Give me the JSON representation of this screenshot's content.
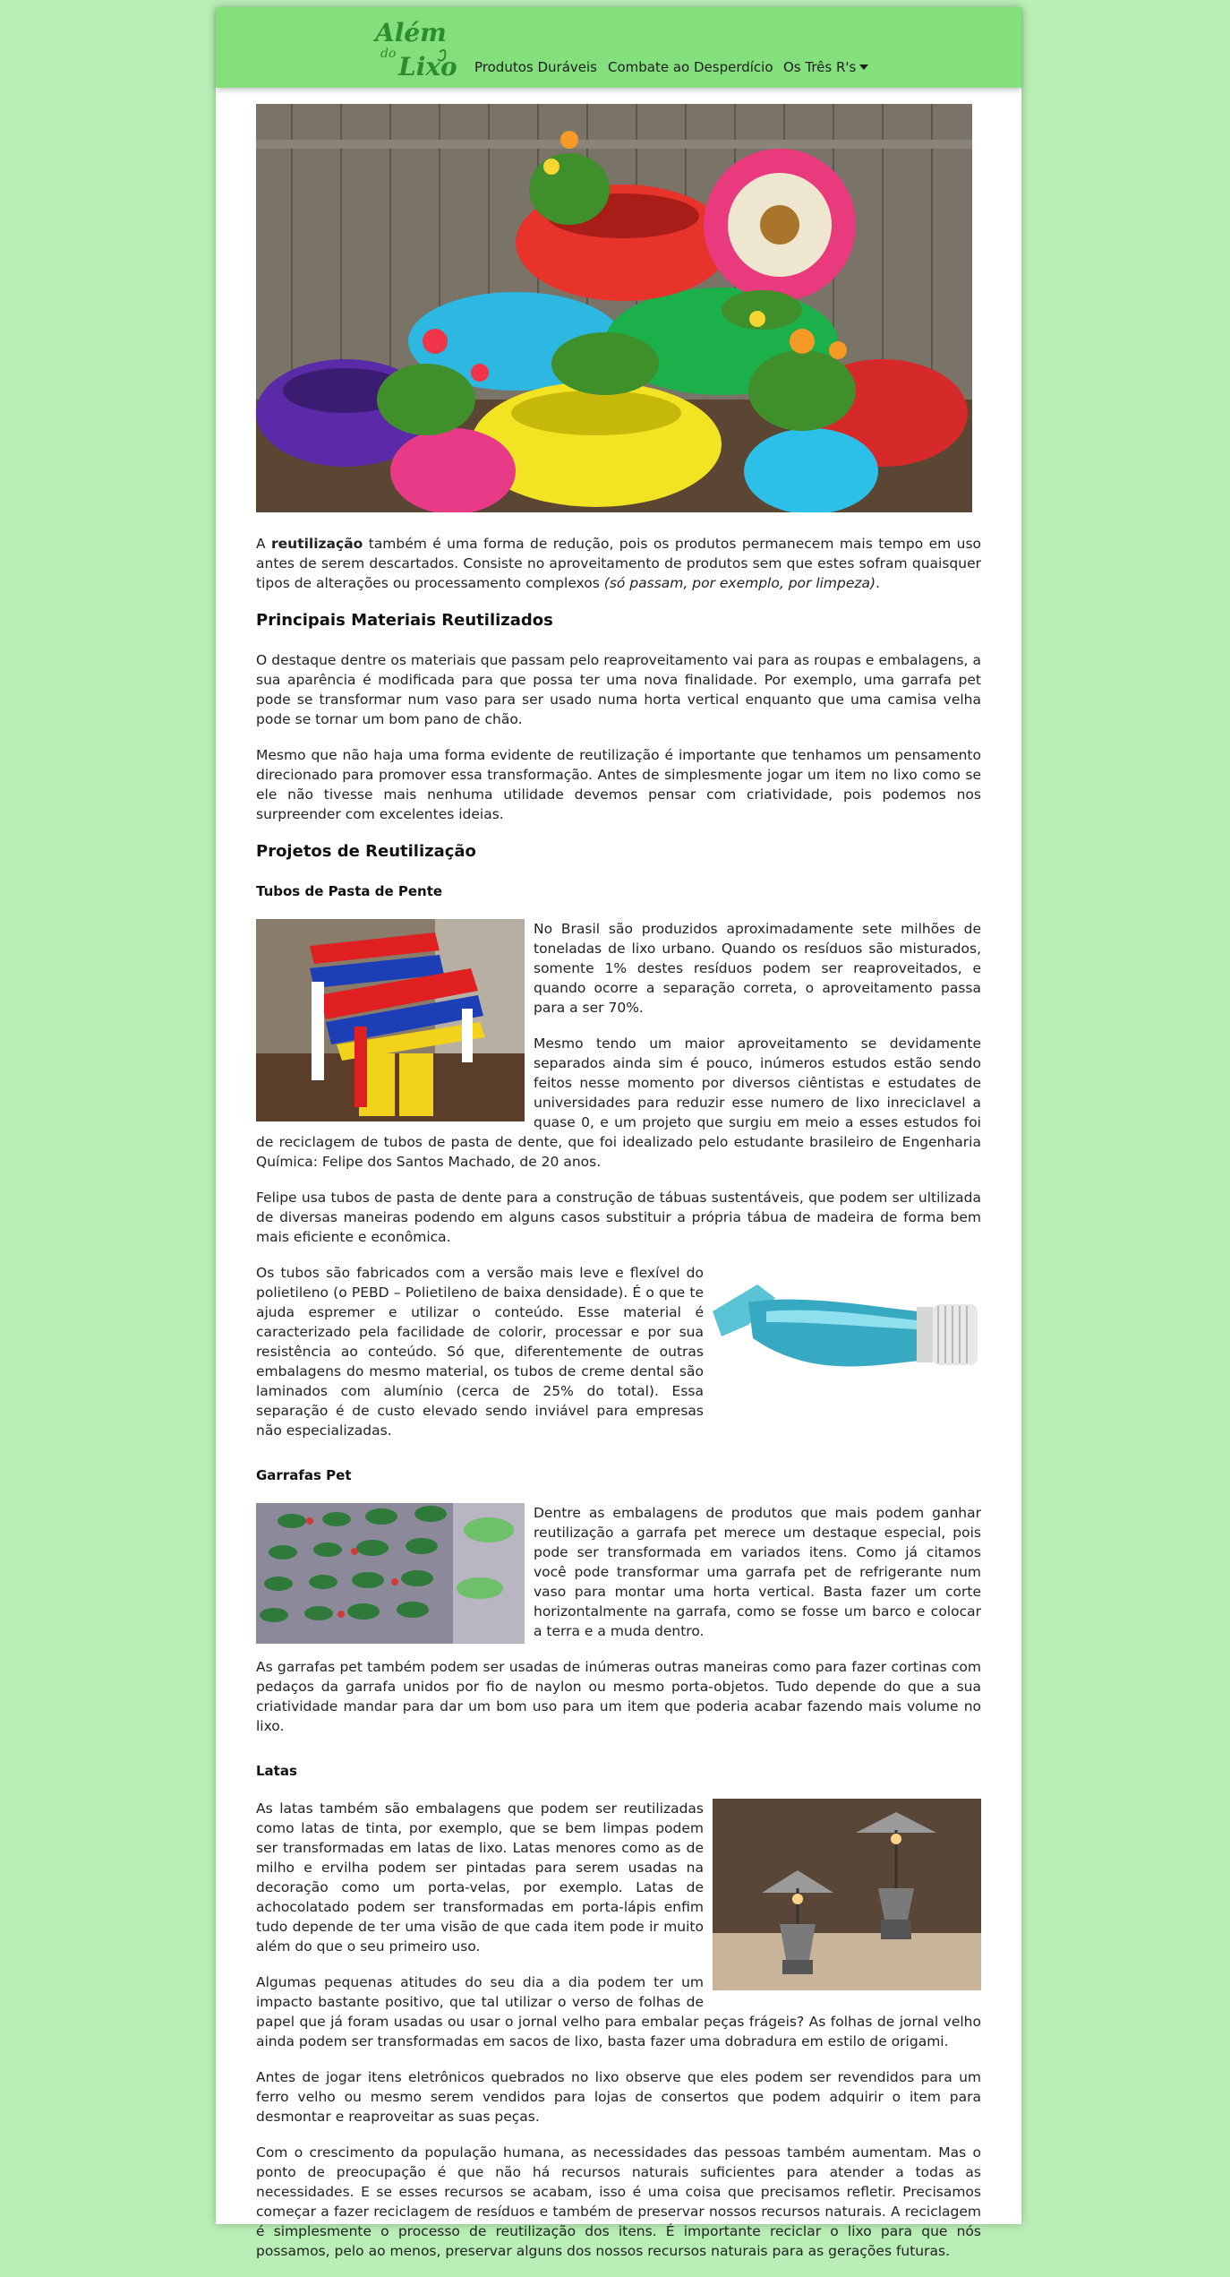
{
  "nav": {
    "logo_text_1": "Além",
    "logo_text_2": "do",
    "logo_text_3": "Lixo",
    "items": [
      {
        "label": "Produtos Duráveis"
      },
      {
        "label": "Combate ao Desperdício"
      },
      {
        "label": "Os Três R's"
      }
    ]
  },
  "colors": {
    "page_bg": "#b9efb6",
    "navbar_bg": "#84e07c",
    "logo_green": "#2e8b2e"
  },
  "intro": {
    "pre": "A ",
    "bold": "reutilização",
    "text": " também é uma forma de redução, pois os produtos permanecem mais tempo em uso antes de serem descartados. Consiste no aproveitamento de produtos sem que estes sofram quaisquer tipos de alterações ou processamento complexos ",
    "italic": "(só passam, por exemplo, por limpeza)",
    "end": "."
  },
  "section1": {
    "heading": "Principais Materiais Reutilizados",
    "p1": "O destaque dentre os materiais que passam pelo reaproveitamento vai para as roupas e embalagens, a sua aparência é modificada para que possa ter uma nova finalidade. Por exemplo, uma garrafa pet pode se transformar num vaso para ser usado numa horta vertical enquanto que uma camisa velha pode se tornar um bom pano de chão.",
    "p2": "Mesmo que não haja uma forma evidente de reutilização é importante que tenhamos um pensamento direcionado para promover essa transformação. Antes de simplesmente jogar um item no lixo como se ele não tivesse mais nenhuma utilidade devemos pensar com criatividade, pois podemos nos surpreender com excelentes ideias."
  },
  "section2": {
    "heading": "Projetos de Reutilização",
    "tubos": {
      "title": "Tubos de Pasta de Pente",
      "p1": "No Brasil são produzidos aproximadamente sete milhões de toneladas de lixo urbano. Quando os resíduos são misturados, somente 1% destes resíduos podem ser reaproveitados, e quando ocorre a separação correta, o aproveitamento passa para a ser 70%.",
      "p2": "Mesmo tendo um maior aproveitamento se devidamente separados ainda sim é pouco, inúmeros estudos estão sendo feitos nesse momento por diversos ciêntistas e estudates de universidades para reduzir esse numero de lixo inreciclavel a quase 0, e um projeto que surgiu em meio a esses estudos foi de reciclagem de tubos de pasta de dente, que foi idealizado pelo estudante brasileiro de Engenharia Química: Felipe dos Santos Machado, de 20 anos.",
      "p3": "Felipe usa tubos de pasta de dente para a construção de tábuas sustentáveis, que podem ser ultilizada de diversas maneiras podendo em alguns casos substituir a própria tábua de madeira de forma bem mais eficiente e econômica.",
      "p4": "Os tubos são fabricados com a versão mais leve e flexível do polietileno (o PEBD – Polietileno de baixa densidade). É o que te ajuda espremer e utilizar o conteúdo. Esse material é caracterizado pela facilidade de colorir, processar e por sua resistência ao conteúdo. Só que, diferentemente de outras embalagens do mesmo material, os tubos de creme dental são laminados com alumínio (cerca de 25% do total). Essa separação é de custo elevado sendo inviável para empresas não especializadas."
    },
    "garrafas": {
      "title": "Garrafas Pet",
      "p1": "Dentre as embalagens de produtos que mais podem ganhar reutilização a garrafa pet merece um destaque especial, pois pode ser transformada em variados itens. Como já citamos você pode transformar uma garrafa pet de refrigerante num vaso para montar uma horta vertical. Basta fazer um corte horizontalmente na garrafa, como se fosse um barco e colocar a terra e a muda dentro.",
      "p2": "As garrafas pet também podem ser usadas de inúmeras outras maneiras como para fazer cortinas com pedaços da garrafa unidos por fio de naylon ou mesmo porta-objetos. Tudo depende do que a sua criatividade mandar para dar um bom uso para um item que poderia acabar fazendo mais volume no lixo."
    },
    "latas": {
      "title": "Latas",
      "p1": "As latas também são embalagens que podem ser reutilizadas como latas de tinta, por exemplo, que se bem limpas podem ser transformadas em latas de lixo. Latas menores como as de milho e ervilha podem ser pintadas para serem usadas na decoração como um porta-velas, por exemplo. Latas de achocolatado podem ser transformadas em porta-lápis enfim tudo depende de ter uma visão de que cada item pode ir muito além do que o seu primeiro uso.",
      "p2": "Algumas pequenas atitudes do seu dia a dia podem ter um impacto bastante positivo, que tal utilizar o verso de folhas de papel que já foram usadas ou usar o jornal velho para embalar peças frágeis? As folhas de jornal velho ainda podem ser transformadas em sacos de lixo, basta fazer uma dobradura em estilo de origami.",
      "p3": "Antes de jogar itens eletrônicos quebrados no lixo observe que eles podem ser revendidos para um ferro velho ou mesmo serem vendidos para lojas de consertos que podem adquirir o item para desmontar e reaproveitar as suas peças.",
      "p4": "Com o crescimento da população humana, as necessidades das pessoas também aumentam. Mas o ponto de preocupação é que não há recursos naturais suficientes para atender a todas as necessidades. E se esses recursos se acabam, isso é uma coisa que precisamos refletir. Precisamos começar a fazer reciclagem de resíduos e também de preservar nossos recursos naturais. A reciclagem é simplesmente o processo de reutilização dos itens. É importante reciclar o lixo para que nós possamos, pelo ao menos, preservar alguns dos nossos recursos naturais para as gerações futuras."
    }
  }
}
